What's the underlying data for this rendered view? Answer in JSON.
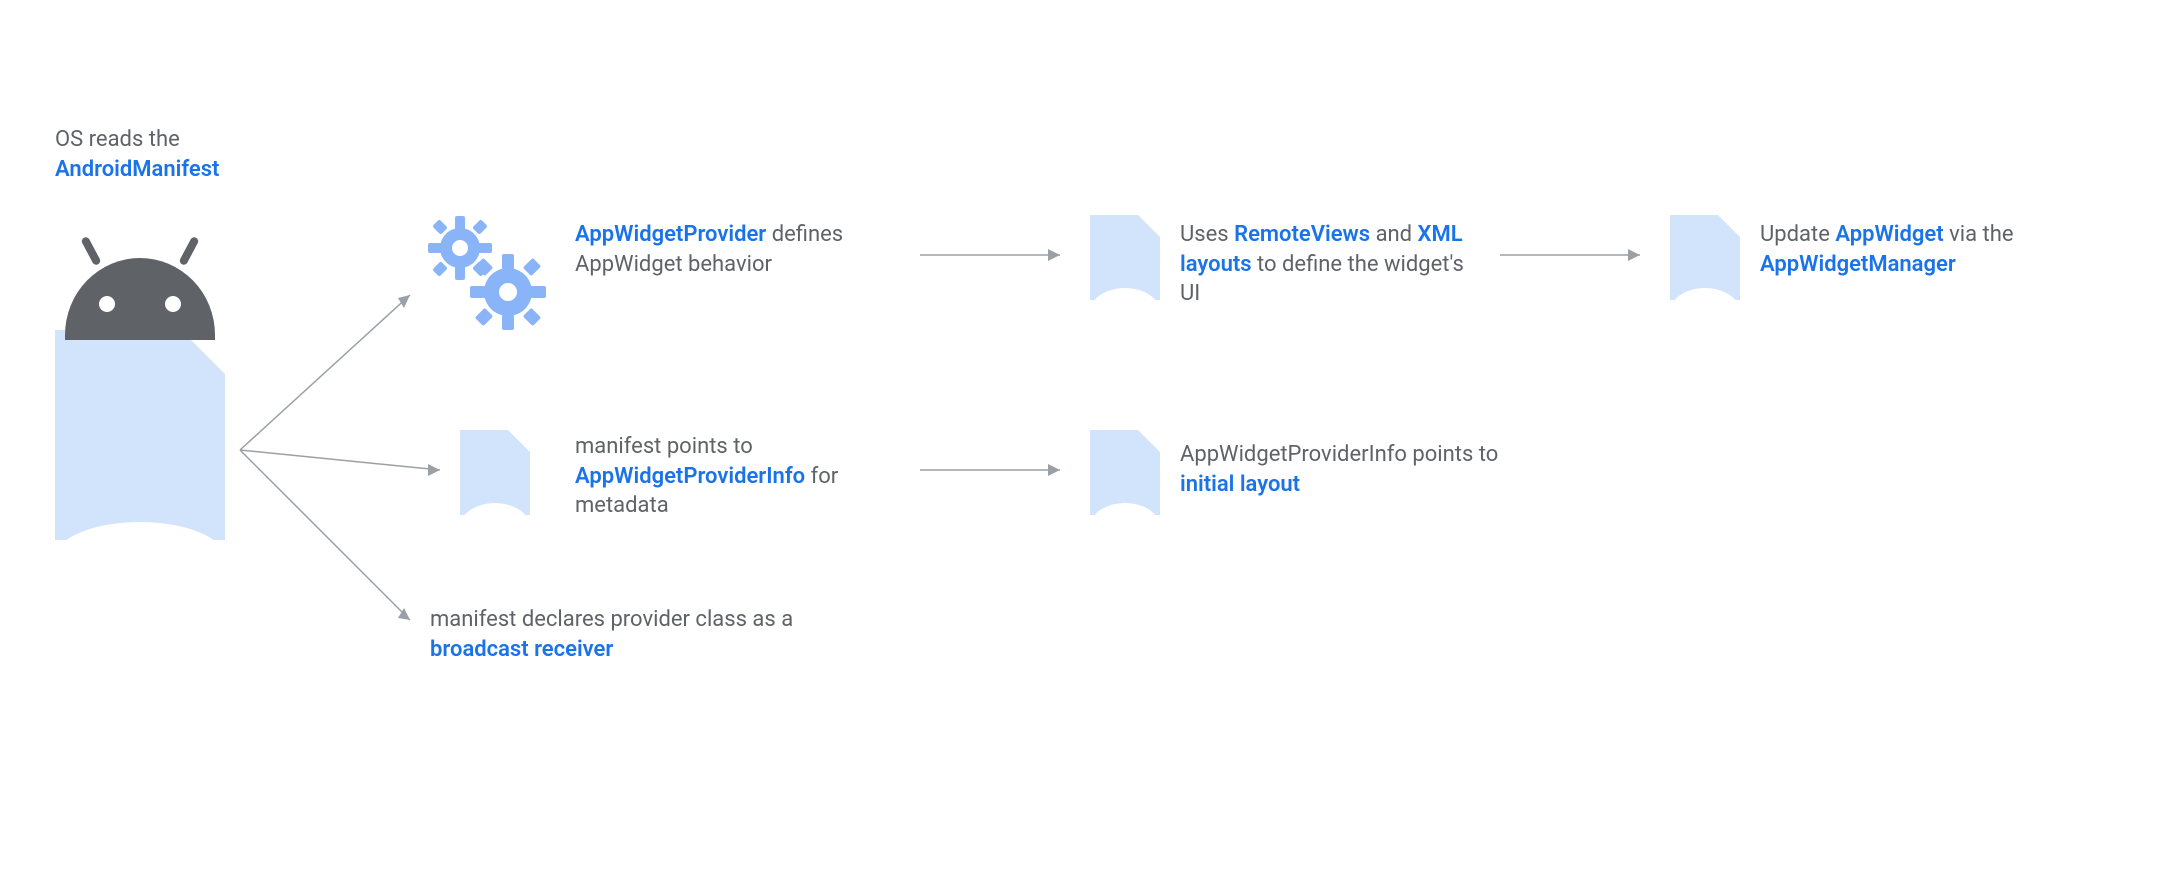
{
  "heading": {
    "plain": "OS reads the",
    "highlight": "AndroidManifest"
  },
  "nodes": {
    "provider": {
      "highlight": "AppWidgetProvider",
      "rest": "defines AppWidget behavior"
    },
    "remoteviews": {
      "pre": "Uses ",
      "hl1": "RemoteViews",
      "mid": " and ",
      "hl2": "XML layouts",
      "post": " to define the widget's UI"
    },
    "manager": {
      "pre": "Update ",
      "hl1": "AppWidget",
      "mid": " via the ",
      "hl2": "AppWidgetManager"
    },
    "providerinfo": {
      "pre": "manifest points to ",
      "hl": "AppWidgetProviderInfo",
      "post": " for metadata"
    },
    "initiallayout": {
      "pre": "AppWidgetProviderInfo points to ",
      "hl": "initial layout"
    },
    "broadcast": {
      "pre": "manifest declares provider class as a ",
      "hl": "broadcast receiver"
    }
  }
}
